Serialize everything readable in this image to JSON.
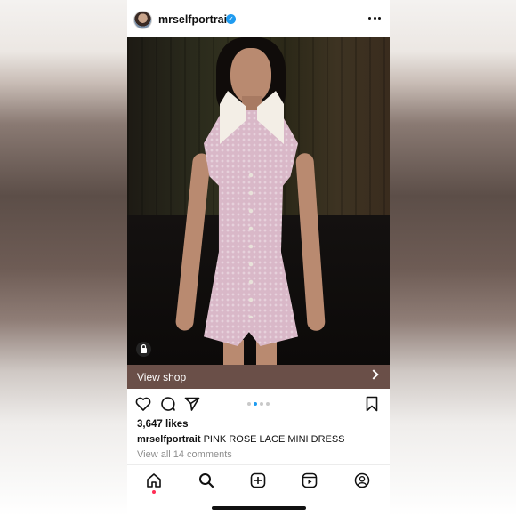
{
  "post": {
    "username": "mrselfportrait",
    "verified_icon": "verified-badge-icon",
    "likes": "3,647 likes",
    "caption_user": "mrselfportrait",
    "caption_text": "PINK ROSE LACE MINI DRESS",
    "comments_link": "View all 14 comments",
    "carousel": {
      "total": 4,
      "active": 2
    }
  },
  "shop_bar": {
    "label": "View shop"
  },
  "icons": {
    "more": "more-options-icon",
    "like": "heart-icon",
    "comment": "comment-icon",
    "share": "send-icon",
    "save": "bookmark-icon",
    "shop_tag": "shopping-bag-icon"
  },
  "bottom_nav": {
    "items": [
      "home-icon",
      "search-icon",
      "create-icon",
      "reels-icon",
      "profile-icon"
    ],
    "active": "home-icon"
  },
  "colors": {
    "shop_bar": "#6a4f48",
    "verified": "#1f9bf0",
    "carousel_active": "#1f9bf0",
    "dress": "#d9b8c8"
  }
}
